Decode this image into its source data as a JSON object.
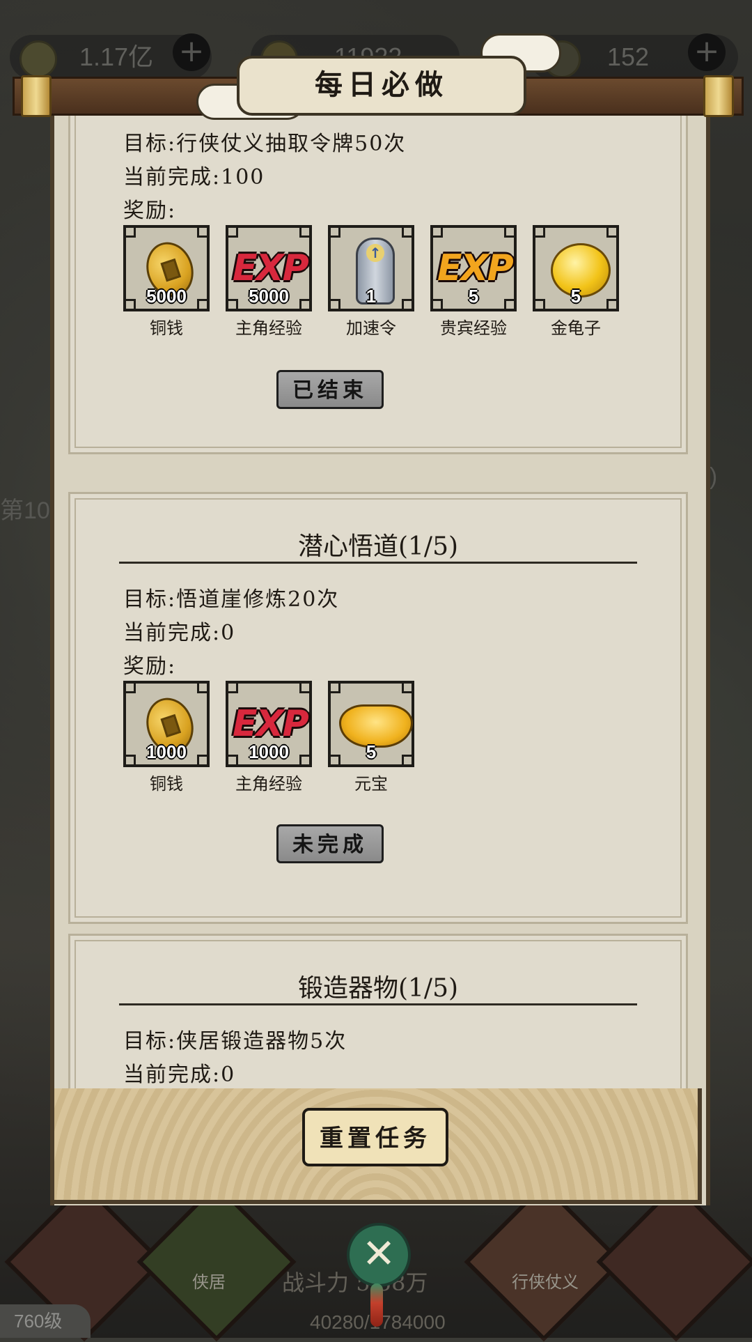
{
  "resources": [
    {
      "value": "1.17亿",
      "icon": "copper-coin-icon"
    },
    {
      "value": "11922",
      "icon": "ingot-icon"
    },
    {
      "value": "152",
      "icon": "gem-icon"
    }
  ],
  "dialog": {
    "title": "每日必做"
  },
  "tasks": [
    {
      "title": "",
      "goal": "目标:行侠仗义抽取令牌50次",
      "progress": "当前完成:100",
      "reward_label": "奖励:",
      "rewards": [
        {
          "icon": "copper-coin-icon",
          "qty": "5000",
          "name": "铜钱"
        },
        {
          "icon": "exp-red-icon",
          "qty": "5000",
          "name": "主角经验"
        },
        {
          "icon": "speedup-token-icon",
          "qty": "1",
          "name": "加速令"
        },
        {
          "icon": "exp-gold-icon",
          "qty": "5",
          "name": "贵宾经验"
        },
        {
          "icon": "golden-turtle-icon",
          "qty": "5",
          "name": "金龟子"
        }
      ],
      "status": "已结束"
    },
    {
      "title": "潜心悟道(1/5)",
      "goal": "目标:悟道崖修炼20次",
      "progress": "当前完成:0",
      "reward_label": "奖励:",
      "rewards": [
        {
          "icon": "copper-coin-icon",
          "qty": "1000",
          "name": "铜钱"
        },
        {
          "icon": "exp-red-icon",
          "qty": "1000",
          "name": "主角经验"
        },
        {
          "icon": "gold-ingot-icon",
          "qty": "5",
          "name": "元宝"
        }
      ],
      "status": "未完成"
    },
    {
      "title": "锻造器物(1/5)",
      "goal": "目标:侠居锻造器物5次",
      "progress": "当前完成:0"
    }
  ],
  "footer": {
    "reset_label": "重置任务"
  },
  "background": {
    "side_text": "第10",
    "side_text_right": "0)",
    "nav_home": "侠居",
    "nav_chivalry": "行侠仗义",
    "power_label": "战斗力",
    "power_value": "5.58万",
    "power_sub": "40280/1784000",
    "level": "760级"
  },
  "close_icon": "close-icon"
}
